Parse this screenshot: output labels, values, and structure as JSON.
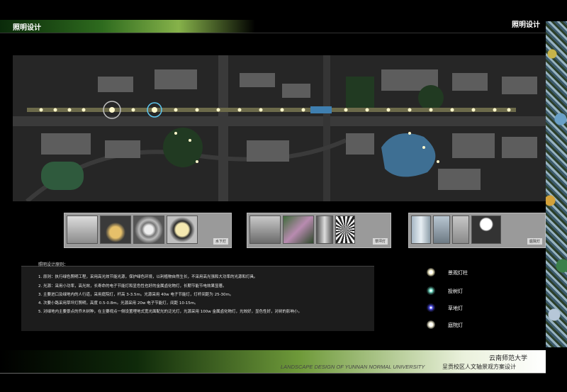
{
  "header": {
    "title_left": "照明设计",
    "title_right": "照明设计"
  },
  "strips": [
    {
      "label": "水下灯"
    },
    {
      "label": "草坪灯"
    },
    {
      "label": "庭院灯"
    }
  ],
  "principles": {
    "title": "照明设计原则：",
    "items": [
      "1. 原则：执行绿色照明工程，采用高光效节能光源，保护绿色环境，以利植物自然生长，不采用高光强和大功率的光源和灯具。",
      "2. 光源：采用小功率，高光效，长寿命的电子节能灯和显色性也好的金属卤化物灯，长期节能节电效果显著。",
      "3. 主要进口及绿地内的人行道，采用庭院灯，杆高 3-3.5m。光源采用 40w 电子节能灯，灯杆间距为 25-30m。",
      "4. 次要小路采用草坪灯照明，高度 0.5-0.8m。光源采用 20w 电子节能灯，间距 10-15m。",
      "5. 对绿地内主要景点的乔木树种，在主要视点一侧设置埋地式宽光面配光的泛光灯，光源采用 100w 金属卤化物灯，光效好，显色性好，对树的影响小。"
    ]
  },
  "legend": [
    {
      "label": "景观灯柱",
      "color": "#f5f0c8"
    },
    {
      "label": "投树灯",
      "color": "#7ff0d8"
    },
    {
      "label": "草地灯",
      "color": "#5a5aff"
    },
    {
      "label": "庭院灯",
      "color": "#f3efd6"
    }
  ],
  "footer": {
    "university_cn": "云南师范大学",
    "university_en": "LANDSCAPE DESIGN OF YUNNAN NORMAL UNIVERSITY",
    "project_cn": "呈贡校区人文轴景观方案设计"
  }
}
